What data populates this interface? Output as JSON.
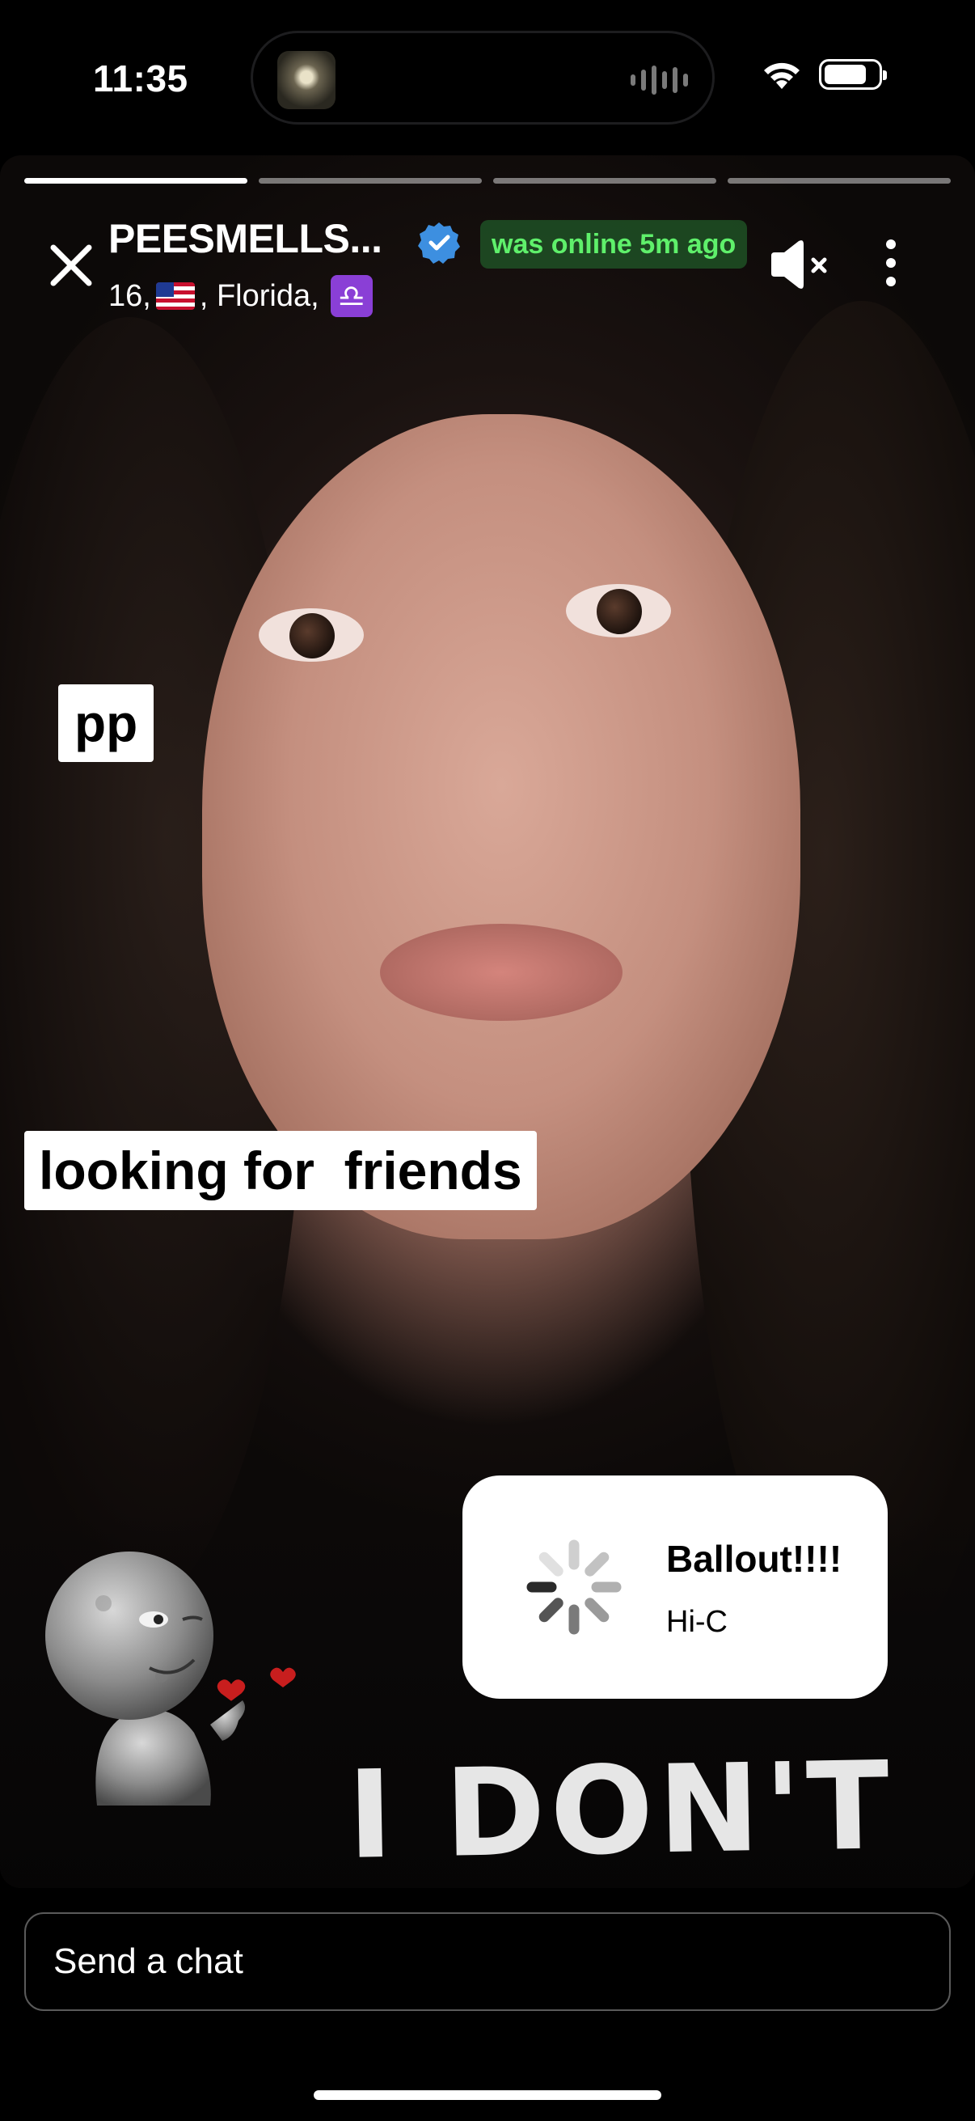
{
  "status_bar": {
    "time": "11:35",
    "icons": [
      "wifi-icon",
      "battery-icon"
    ],
    "now_playing_icon": "audio-waveform-icon"
  },
  "story": {
    "segments": 4,
    "active_segment": 1,
    "user": {
      "name": "PEESMELLS...",
      "verified": true,
      "online_status": "was online 5m ago",
      "age": "16,",
      "flag": "US",
      "location": ", Florida,",
      "zodiac": "♎"
    },
    "stickers": {
      "pp": "pp",
      "caption": "looking for  friends"
    },
    "music": {
      "title": "Ballout!!!!",
      "artist": "Hi-C"
    },
    "shirt_text": "I DON'T"
  },
  "chat": {
    "placeholder": "Send a chat"
  },
  "colors": {
    "online_green": "#5ff06b",
    "verified_blue": "#3d8fe0",
    "zodiac_purple": "#8a3fd6"
  }
}
